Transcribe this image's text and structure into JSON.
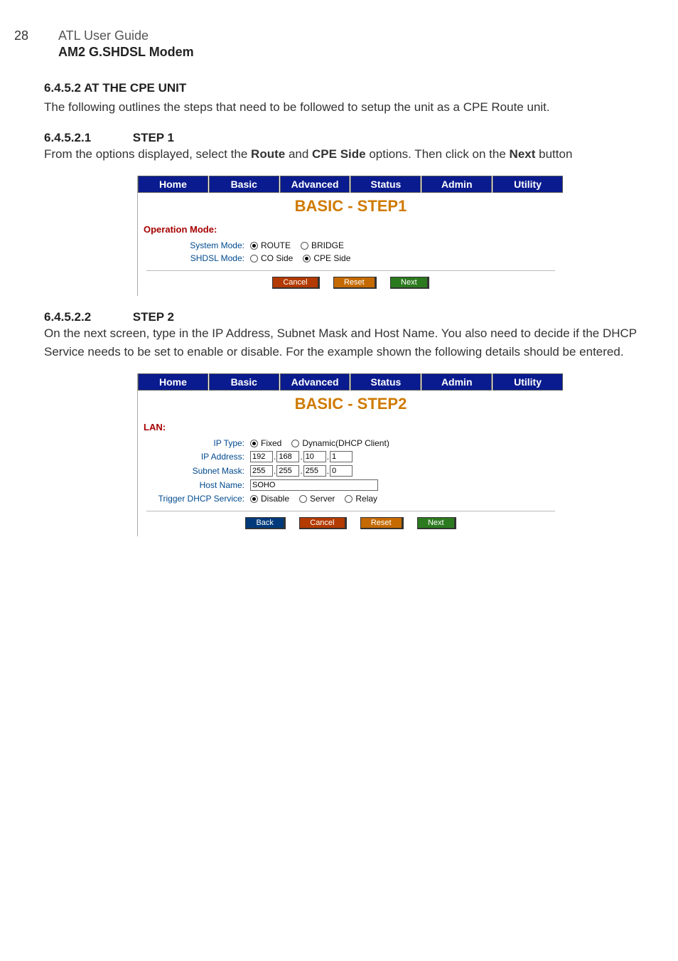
{
  "header": {
    "page_number": "28",
    "guide_title": "ATL User Guide",
    "guide_subtitle": "AM2 G.SHDSL Modem"
  },
  "section_6_4_5_2": {
    "number_title": "6.4.5.2 AT THE CPE UNIT",
    "intro": "The following outlines the steps that need to be followed to setup the unit as a CPE Route unit."
  },
  "step1": {
    "num": "6.4.5.2.1",
    "label": "STEP 1",
    "text_parts": {
      "a": "From the options displayed, select the ",
      "b": "Route",
      "c": " and ",
      "d": "CPE Side",
      "e": " options. Then click on the ",
      "f": "Next",
      "g": " button"
    }
  },
  "step2": {
    "num": "6.4.5.2.2",
    "label": "STEP 2",
    "text": "On the next screen, type in the IP Address, Subnet Mask and Host Name. You also need to decide if the DHCP Service needs to be set to enable or disable. For the example shown the following details should be entered."
  },
  "shared": {
    "tabs": {
      "home": "Home",
      "basic": "Basic",
      "advanced": "Advanced",
      "status": "Status",
      "admin": "Admin",
      "utility": "Utility"
    },
    "btn_cancel": "Cancel",
    "btn_reset": "Reset",
    "btn_next": "Next",
    "btn_back": "Back"
  },
  "shot1": {
    "title": "BASIC - STEP1",
    "section": "Operation Mode:",
    "system_mode_label": "System Mode:",
    "system_mode": {
      "route": "ROUTE",
      "bridge": "BRIDGE",
      "selected": "route"
    },
    "shdsl_mode_label": "SHDSL Mode:",
    "shdsl_mode": {
      "co": "CO Side",
      "cpe": "CPE Side",
      "selected": "cpe"
    }
  },
  "shot2": {
    "title": "BASIC - STEP2",
    "section": "LAN:",
    "ip_type_label": "IP Type:",
    "ip_type": {
      "fixed": "Fixed",
      "dynamic": "Dynamic(DHCP Client)",
      "selected": "fixed"
    },
    "ip_address_label": "IP Address:",
    "ip_address": [
      "192",
      "168",
      "10",
      "1"
    ],
    "subnet_label": "Subnet Mask:",
    "subnet_mask": [
      "255",
      "255",
      "255",
      "0"
    ],
    "host_name_label": "Host Name:",
    "host_name": "SOHO",
    "dhcp_label": "Trigger DHCP Service:",
    "dhcp": {
      "disable": "Disable",
      "server": "Server",
      "relay": "Relay",
      "selected": "disable"
    }
  },
  "chart_data": {
    "type": "table",
    "title": "BASIC - STEP2 form values",
    "rows": [
      {
        "field": "IP Type",
        "value": "Fixed"
      },
      {
        "field": "IP Address",
        "value": "192.168.10.1"
      },
      {
        "field": "Subnet Mask",
        "value": "255.255.255.0"
      },
      {
        "field": "Host Name",
        "value": "SOHO"
      },
      {
        "field": "Trigger DHCP Service",
        "value": "Disable"
      }
    ]
  }
}
